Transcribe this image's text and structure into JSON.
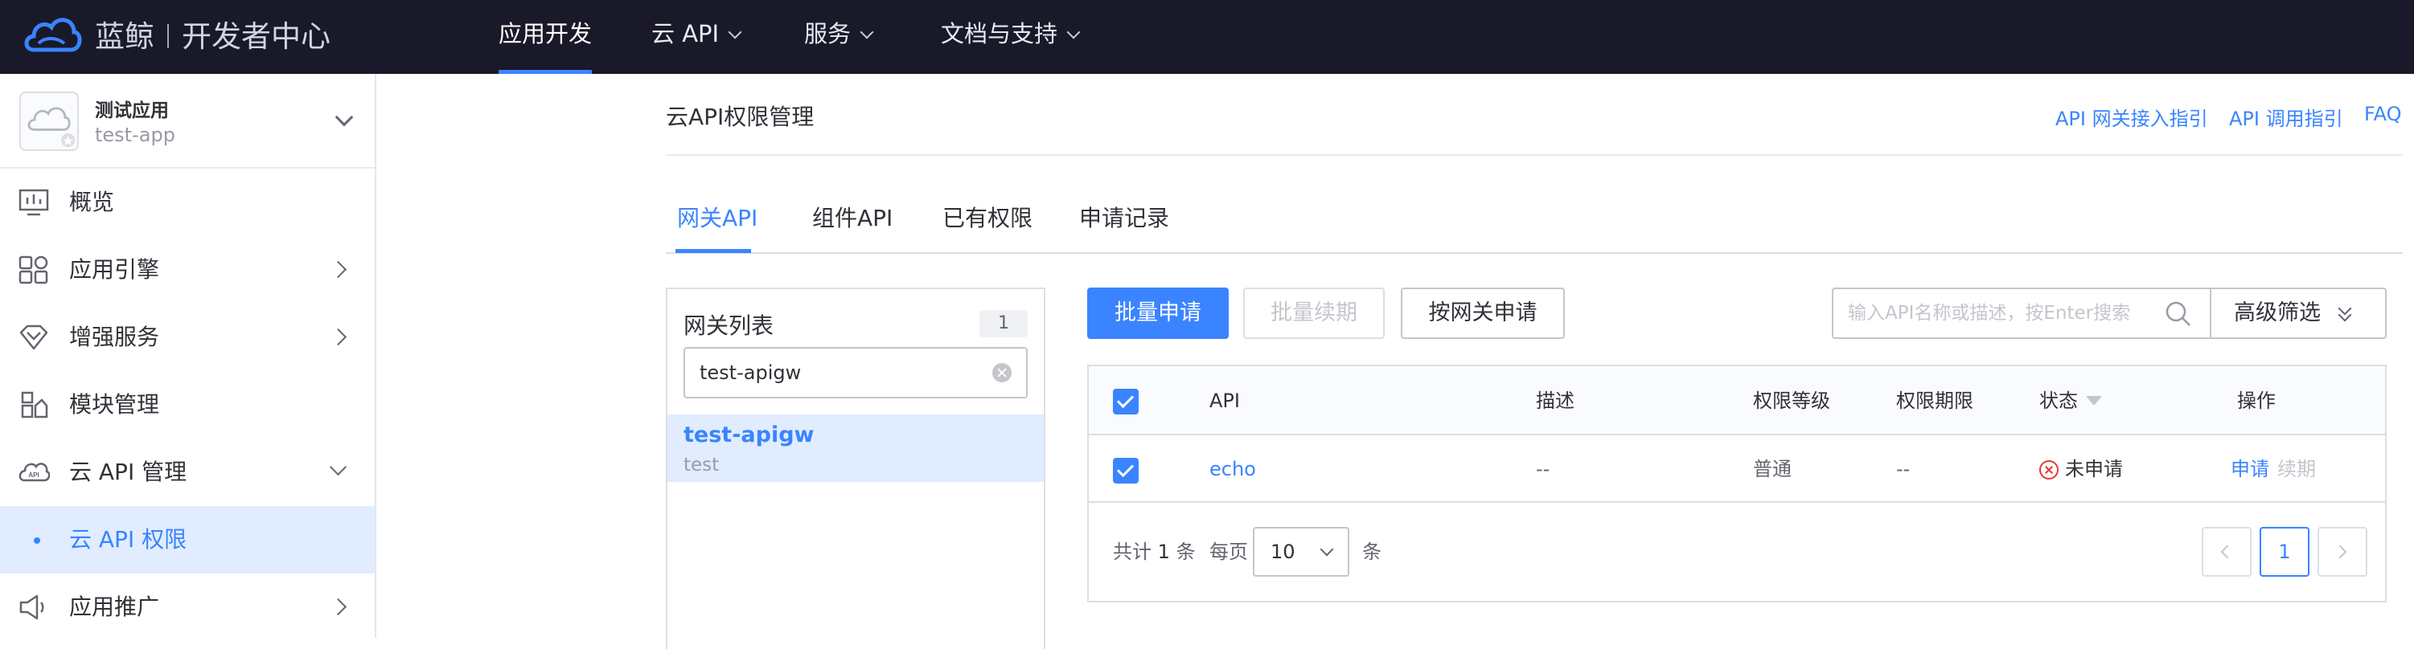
{
  "brand": {
    "name": "蓝鲸",
    "product": "开发者中心"
  },
  "topnav": [
    {
      "label": "应用开发",
      "active": true
    },
    {
      "label": "云 API",
      "dropdown": true
    },
    {
      "label": "服务",
      "dropdown": true
    },
    {
      "label": "文档与支持",
      "dropdown": true
    }
  ],
  "app": {
    "name": "测试应用",
    "code": "test-app"
  },
  "sidebar": {
    "items": [
      {
        "label": "概览",
        "icon": "chart-icon"
      },
      {
        "label": "应用引擎",
        "icon": "modules-icon",
        "expandable": true
      },
      {
        "label": "增强服务",
        "icon": "diamond-icon",
        "expandable": true
      },
      {
        "label": "模块管理",
        "icon": "module-icon"
      },
      {
        "label": "云 API 管理",
        "icon": "api-icon",
        "expanded": true
      },
      {
        "label": "云 API 权限",
        "sub": true,
        "active": true
      },
      {
        "label": "应用推广",
        "icon": "megaphone-icon",
        "expandable": true
      }
    ]
  },
  "page": {
    "title": "云API权限管理",
    "links": [
      "API 网关接入指引",
      "API 调用指引",
      "FAQ"
    ]
  },
  "tabs": [
    {
      "label": "网关API",
      "active": true
    },
    {
      "label": "组件API"
    },
    {
      "label": "已有权限"
    },
    {
      "label": "申请记录"
    }
  ],
  "gateway_list": {
    "title": "网关列表",
    "count": "1",
    "search_value": "test-apigw",
    "items": [
      {
        "name": "test-apigw",
        "desc": "test"
      }
    ]
  },
  "toolbar": {
    "batch_apply": "批量申请",
    "batch_renew": "批量续期",
    "apply_by_gateway": "按网关申请",
    "search_placeholder": "输入API名称或描述，按Enter搜索",
    "advanced_filter": "高级筛选"
  },
  "table": {
    "columns": [
      "API",
      "描述",
      "权限等级",
      "权限期限",
      "状态",
      "操作"
    ],
    "rows": [
      {
        "api": "echo",
        "desc": "--",
        "level": "普通",
        "term": "--",
        "status": "未申请",
        "actions": [
          "申请",
          "续期"
        ]
      }
    ]
  },
  "pagination": {
    "total_prefix": "共计",
    "total": "1",
    "total_suffix": "条",
    "per_page_label": "每页",
    "per_page": "10",
    "per_page_suffix": "条",
    "current_page": "1"
  },
  "colors": {
    "primary": "#3a84ff",
    "nav_bg": "#191929",
    "danger": "#ea3636"
  }
}
